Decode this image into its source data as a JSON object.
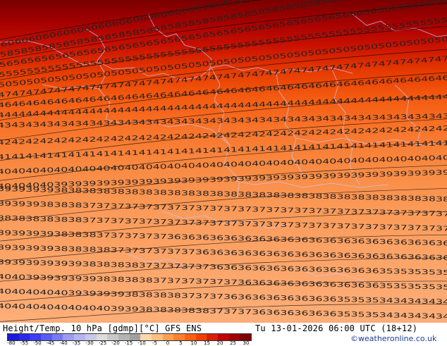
{
  "map": {
    "field": "geopotential height / temperature 10 hPa",
    "row_values": [
      "6060606060606060606060606060606060606060606060606060606060606060",
      "5858585858585858585858585858585858585858585858585858585858585858",
      "5656565656565656565656565656565656565656565656565656565656565656",
      "5555555555555555555555555555555555555555555555555555555555555555",
      "5050505050505050505050505050505050505050505050505050505050505050",
      "4747474747474747474747474747474747474747474747474747474747474747",
      "4646464646464646464646464646464646464646464646464646464646464646",
      "4444444444444444444444444444444444444444444444444444444444444444",
      "4343434343434343434343434343434343434343434343434343434343434343",
      "4242424242424242424242424242424242424242424242424242424242424242",
      "4141414141414141414141414141414141414141414141414141414141414141",
      "4040404040404040404040404040404040404040404040404040404040404040",
      "4040404039393939393939393939393939393939393939393939393939393939",
      "3939393938383838383838383838383838383838383838383838383838383838",
      "3939393838383737373737373737373737373737373737373737373737373737",
      "3838383838383737373737373737373737373737373737373737373737373737",
      "3939393938383837373737373636363636363636363636363636363636363636",
      "3939393938383838373737373737363636363636363636363636363636363636",
      "3939393939393838383837373737373636363636363636363636363535353535",
      "4040393939393938383838373737373737363636363636363636363535353535",
      "4040404040393939393838383837373736363636363636363535353434343434",
      "4040404040404040393938383838383737373636363636363535353434343434"
    ]
  },
  "footer": {
    "title": "Height/Temp. 10 hPa [gdmp][°C] GFS ENS",
    "valid_time": "Tu 13-01-2026 06:00 UTC (18+12)",
    "credit": "©weatheronline.co.uk",
    "colorbar_colors": [
      "#1a1ad8",
      "#2a2ae8",
      "#3c3cf0",
      "#5a5af5",
      "#7878f5",
      "#9c9cf5",
      "#b4b4f0",
      "#c8c8e8",
      "#dcdcdc",
      "#c8c8c8",
      "#b4b4b4",
      "#a0a0a0",
      "#ffd8a8",
      "#ffc080",
      "#ffa050",
      "#ff8030",
      "#ff6010",
      "#f04000",
      "#d82000",
      "#c00000",
      "#a00000",
      "#800000"
    ],
    "colorbar_ticks": [
      "-80",
      "-55",
      "-50",
      "-45",
      "-40",
      "-35",
      "-30",
      "-25",
      "-20",
      "-15",
      "-10",
      "-5",
      "0",
      "5",
      "10",
      "15",
      "20",
      "25",
      "30"
    ]
  },
  "colors": {
    "credit": "#1a3c9a",
    "border_lines": "#c8c8ff"
  }
}
